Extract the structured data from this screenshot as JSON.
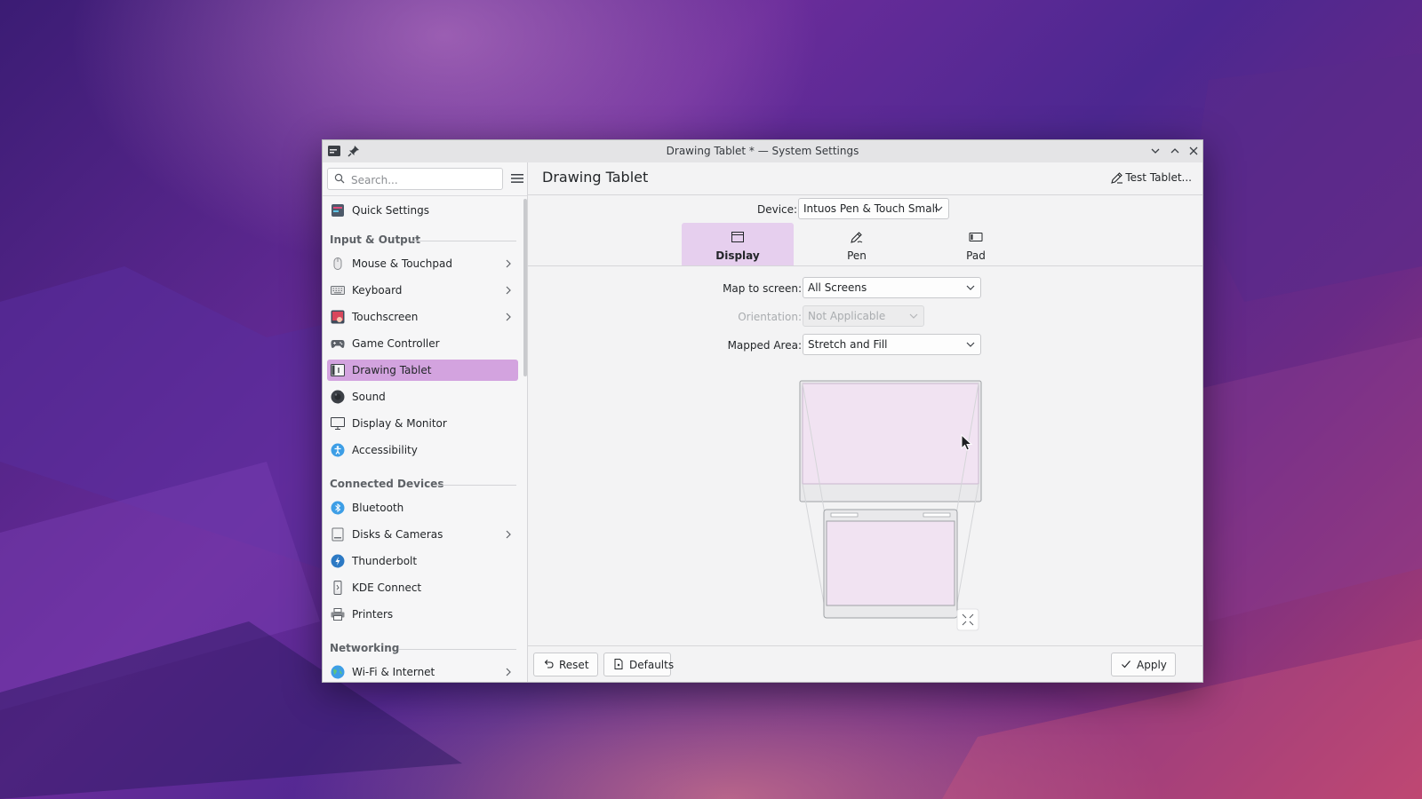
{
  "window": {
    "title": "Drawing Tablet * — System Settings"
  },
  "sidebar": {
    "search_placeholder": "Search...",
    "quick_settings": "Quick Settings",
    "categories": {
      "input_output": "Input & Output",
      "connected_devices": "Connected Devices",
      "networking": "Networking"
    },
    "items": [
      {
        "label": "Mouse & Touchpad",
        "icon": "mouse-icon",
        "chevron": true
      },
      {
        "label": "Keyboard",
        "icon": "keyboard-icon",
        "chevron": true
      },
      {
        "label": "Touchscreen",
        "icon": "touchscreen-icon",
        "chevron": true
      },
      {
        "label": "Game Controller",
        "icon": "gamepad-icon",
        "chevron": false
      },
      {
        "label": "Drawing Tablet",
        "icon": "tablet-icon",
        "chevron": false,
        "active": true
      },
      {
        "label": "Sound",
        "icon": "speaker-icon",
        "chevron": false
      },
      {
        "label": "Display & Monitor",
        "icon": "monitor-icon",
        "chevron": false
      },
      {
        "label": "Accessibility",
        "icon": "accessibility-icon",
        "chevron": false
      },
      {
        "label": "Bluetooth",
        "icon": "bluetooth-icon",
        "chevron": false
      },
      {
        "label": "Disks & Cameras",
        "icon": "disk-icon",
        "chevron": true
      },
      {
        "label": "Thunderbolt",
        "icon": "thunderbolt-icon",
        "chevron": false
      },
      {
        "label": "KDE Connect",
        "icon": "phone-icon",
        "chevron": false
      },
      {
        "label": "Printers",
        "icon": "printer-icon",
        "chevron": false
      },
      {
        "label": "Wi-Fi & Internet",
        "icon": "globe-icon",
        "chevron": true
      }
    ]
  },
  "header": {
    "page_title": "Drawing Tablet",
    "test_tablet": "Test Tablet..."
  },
  "device": {
    "label": "Device:",
    "value": "Intuos Pen & Touch Small"
  },
  "tabs": [
    {
      "label": "Display",
      "icon": "display-icon",
      "active": true
    },
    {
      "label": "Pen",
      "icon": "pen-icon",
      "active": false
    },
    {
      "label": "Pad",
      "icon": "pad-icon",
      "active": false
    }
  ],
  "form": {
    "map_to_screen": {
      "label": "Map to screen:",
      "value": "All Screens"
    },
    "orientation": {
      "label": "Orientation:",
      "value": "Not Applicable",
      "disabled": true
    },
    "mapped_area": {
      "label": "Mapped Area:",
      "value": "Stretch and Fill"
    }
  },
  "footer": {
    "reset": "Reset",
    "defaults": "Defaults",
    "apply": "Apply"
  },
  "colors": {
    "accent": "#d3a3df",
    "active_tab": "#e6cfee",
    "preview_fill": "#f1e3f2"
  }
}
